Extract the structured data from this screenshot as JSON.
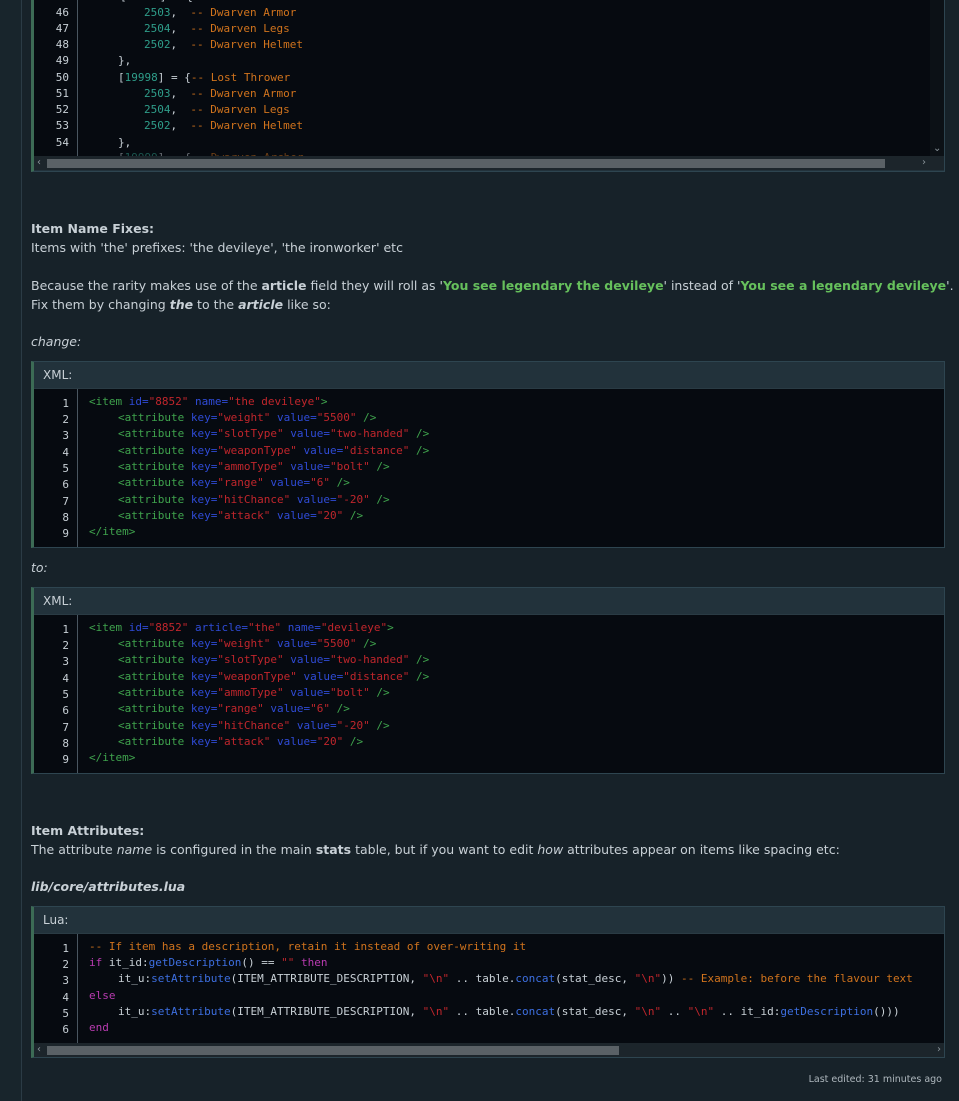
{
  "top_block": {
    "lines": [
      {
        "n": "46",
        "num": "2503",
        "cmt": "-- Dwarven Armor"
      },
      {
        "n": "47",
        "num": "2504",
        "cmt": "-- Dwarven Legs"
      },
      {
        "n": "48",
        "num": "2502",
        "cmt": "-- Dwarven Helmet"
      },
      {
        "n": "49",
        "plain": "},"
      },
      {
        "n": "50",
        "bracket_num": "19998",
        "cmt": "{-- Lost Thrower"
      },
      {
        "n": "51",
        "num": "2503",
        "cmt": "-- Dwarven Armor"
      },
      {
        "n": "52",
        "num": "2504",
        "cmt": "-- Dwarven Legs"
      },
      {
        "n": "53",
        "num": "2502",
        "cmt": "-- Dwarven Helmet"
      },
      {
        "n": "54",
        "plain": "},"
      }
    ]
  },
  "section1": {
    "heading": "Item Name Fixes:",
    "line1": "Items with 'the' prefixes: 'the devileye', 'the ironworker' etc",
    "p2_a": "Because the rarity makes use of the ",
    "p2_b": "article",
    "p2_c": " field they will roll as '",
    "p2_d": "You see legendary the devileye",
    "p2_e": "' instead of '",
    "p2_f": "You see a legendary devileye",
    "p2_g": "'.",
    "p3_a": "Fix them by changing ",
    "p3_b": "the",
    "p3_c": " to the ",
    "p3_d": "article",
    "p3_e": " like so:",
    "change": "change:",
    "to": "to:"
  },
  "xml_label": "XML:",
  "lua_label": "Lua:",
  "section2": {
    "heading": "Item Attributes:",
    "a": "The attribute ",
    "b": "name",
    "c": " is configured in the main ",
    "d": "stats",
    "e": " table, but if you want to edit ",
    "f": "how",
    "g": " attributes appear on items like spacing etc:",
    "path": "lib/core/attributes.lua"
  },
  "footer": {
    "last_edited": "Last edited: 31 minutes ago"
  }
}
